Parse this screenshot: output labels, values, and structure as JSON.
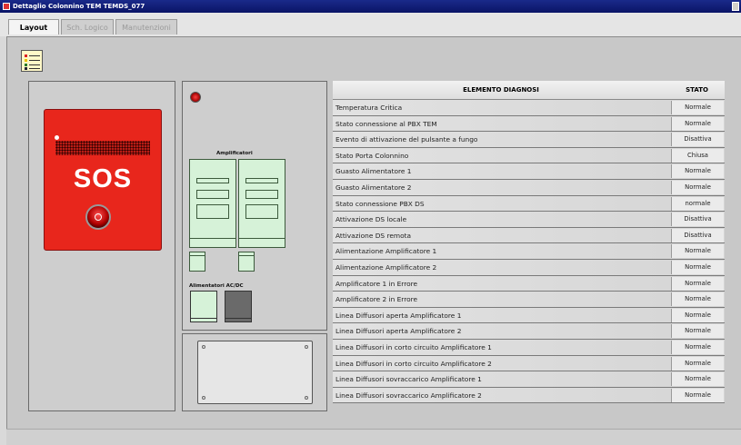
{
  "window": {
    "title": "Dettaglio Colonnino TEM TEMDS_077"
  },
  "tabs": [
    {
      "label": "Layout",
      "active": true
    },
    {
      "label": "Sch. Logico",
      "active": false
    },
    {
      "label": "Manutenzioni",
      "active": false
    }
  ],
  "sos_panel": {
    "label": "SOS"
  },
  "equipment": {
    "amplifiers_label": "Amplificatori",
    "psu_label": "Alimentatori AC/DC"
  },
  "table": {
    "headers": {
      "element": "ELEMENTO DIAGNOSI",
      "status": "STATO"
    },
    "rows": [
      {
        "element": "Temperatura Critica",
        "status": "Normale"
      },
      {
        "element": "Stato connessione al PBX TEM",
        "status": "Normale"
      },
      {
        "element": "Evento di attivazione del pulsante a fungo",
        "status": "Disattiva"
      },
      {
        "element": "Stato Porta Colonnino",
        "status": "Chiusa"
      },
      {
        "element": "Guasto Alimentatore 1",
        "status": "Normale"
      },
      {
        "element": "Guasto Alimentatore 2",
        "status": "Normale"
      },
      {
        "element": "Stato connessione PBX DS",
        "status": "normale"
      },
      {
        "element": "Attivazione DS locale",
        "status": "Disattiva"
      },
      {
        "element": "Attivazione DS remota",
        "status": "Disattiva"
      },
      {
        "element": "Alimentazione Amplificatore 1",
        "status": "Normale"
      },
      {
        "element": "Alimentazione Amplificatore 2",
        "status": "Normale"
      },
      {
        "element": "Amplificatore 1 in Errore",
        "status": "Normale"
      },
      {
        "element": "Amplificatore 2 in Errore",
        "status": "Normale"
      },
      {
        "element": "Linea Diffusori aperta Amplificatore 1",
        "status": "Normale"
      },
      {
        "element": "Linea Diffusori aperta Amplificatore 2",
        "status": "Normale"
      },
      {
        "element": "Linea Diffusori in corto circuito Amplificatore 1",
        "status": "Normale"
      },
      {
        "element": "Linea Diffusori in corto circuito Amplificatore 2",
        "status": "Normale"
      },
      {
        "element": "Linea Diffusori sovraccarico Amplificatore 1",
        "status": "Normale"
      },
      {
        "element": "Linea Diffusori sovraccarico Amplificatore 2",
        "status": "Normale"
      }
    ]
  },
  "colors": {
    "titlebar": "#0a1466",
    "sos_red": "#e8261c",
    "amplifier_green": "#d6f2d8",
    "psu_gray": "#6a6a6a",
    "panel_gray": "#cecece"
  },
  "icons": {
    "window_icon": "app-icon",
    "legend_button": "legend-list-icon",
    "alarm_indicator": "alarm-led-icon",
    "sos_push_button": "red-button-icon"
  }
}
